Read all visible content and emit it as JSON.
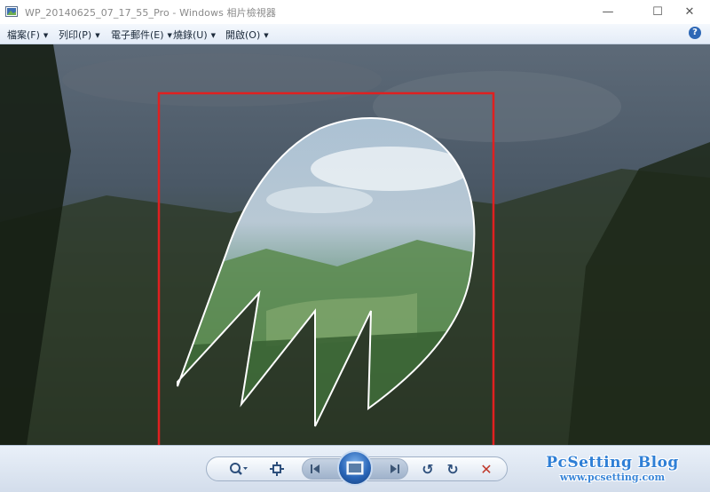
{
  "window": {
    "title": "WP_20140625_07_17_55_Pro - Windows 相片檢視器",
    "minimize": "—",
    "maximize": "☐",
    "close": "✕"
  },
  "menu": {
    "items": [
      {
        "label": "檔案(F)"
      },
      {
        "label": "列印(P)"
      },
      {
        "label": "電子郵件(E)"
      },
      {
        "label": "燒錄(U)"
      },
      {
        "label": "開啟(O)"
      }
    ],
    "help": "?"
  },
  "toolbar": {
    "icons": [
      "zoom-icon",
      "actual-size-icon",
      "previous-icon",
      "slideshow-icon",
      "next-icon",
      "rotate-left-icon",
      "rotate-right-icon",
      "delete-icon"
    ],
    "delete_color": "#c0392b"
  },
  "annotation": {
    "highlight_color": "#e02020",
    "shape_color": "#ffffff"
  },
  "watermark": {
    "name": "PcSetting Blog",
    "url": "www.pcsetting.com"
  }
}
